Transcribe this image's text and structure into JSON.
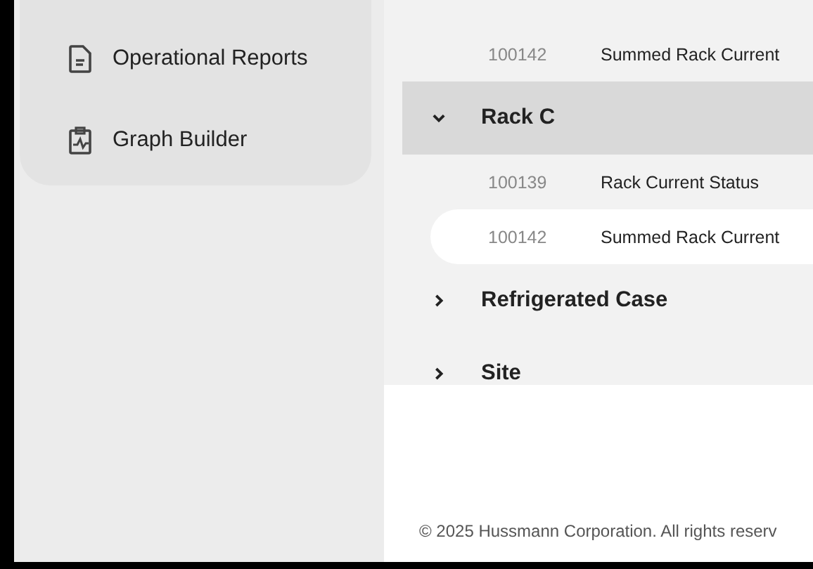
{
  "sidebar": {
    "items": [
      {
        "kind": "report",
        "label": "Operational Reports"
      },
      {
        "kind": "graph",
        "label": "Graph Builder"
      }
    ]
  },
  "points_above": [
    {
      "id": "100142",
      "name": "Summed Rack Current",
      "selected": false
    }
  ],
  "groups": [
    {
      "label": "Rack C",
      "expanded": true,
      "selected": true,
      "children": [
        {
          "id": "100139",
          "name": "Rack Current Status",
          "selected": false
        },
        {
          "id": "100142",
          "name": "Summed Rack Current",
          "selected": true
        }
      ]
    },
    {
      "label": "Refrigerated Case",
      "expanded": false,
      "selected": false
    },
    {
      "label": "Site",
      "expanded": false,
      "selected": false
    }
  ],
  "footer": "© 2025 Hussmann Corporation. All rights reserv"
}
